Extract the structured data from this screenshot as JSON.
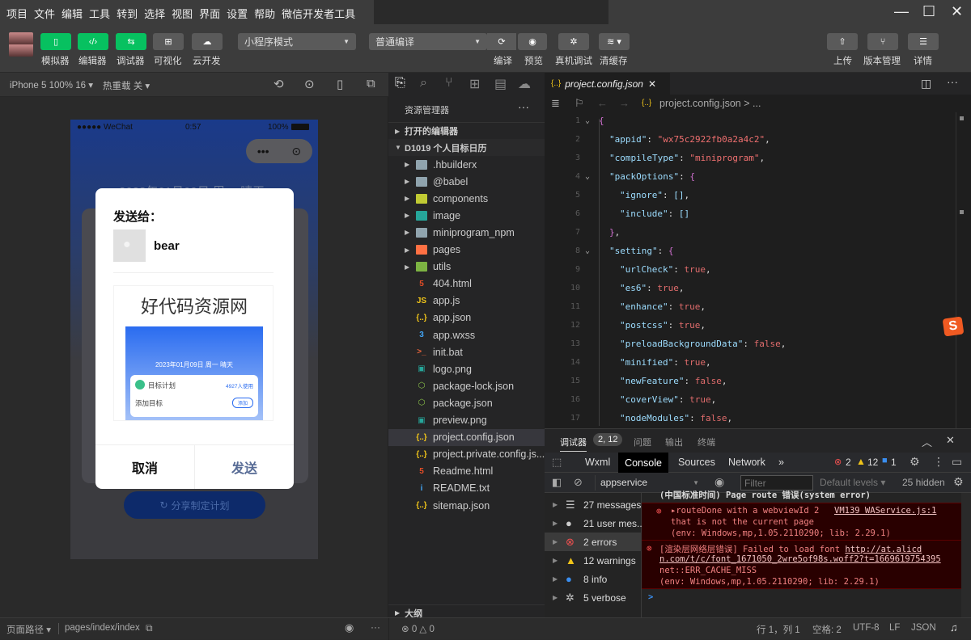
{
  "menubar": {
    "items": [
      "项目",
      "文件",
      "编辑",
      "工具",
      "转到",
      "选择",
      "视图",
      "界面",
      "设置",
      "帮助",
      "微信开发者工具"
    ]
  },
  "window_controls": {
    "minimize": "—",
    "maximize": "☐",
    "close": "✕"
  },
  "toolbar": {
    "left_buttons": [
      {
        "label": "模拟器",
        "icon": "phone-icon",
        "active": true
      },
      {
        "label": "编辑器",
        "icon": "code-icon",
        "active": true
      },
      {
        "label": "调试器",
        "icon": "sliders-icon",
        "active": true
      },
      {
        "label": "可视化",
        "icon": "layout-icon",
        "active": false
      },
      {
        "label": "云开发",
        "icon": "cloud-icon",
        "active": false
      }
    ],
    "mode_select": "小程序模式",
    "compile_select": "普通编译",
    "mid_buttons": [
      {
        "label": "编译",
        "icon": "refresh-icon"
      },
      {
        "label": "预览",
        "icon": "eye-icon"
      },
      {
        "label": "真机调试",
        "icon": "bug-icon"
      },
      {
        "label": "清缓存",
        "icon": "layers-icon"
      }
    ],
    "right_buttons": [
      {
        "label": "上传",
        "icon": "upload-icon"
      },
      {
        "label": "版本管理",
        "icon": "branch-icon"
      },
      {
        "label": "详情",
        "icon": "menu-icon"
      }
    ],
    "accent": "#07c160"
  },
  "simulator": {
    "device": "iPhone 5 100% 16",
    "hot_reload": "热重载 关",
    "status_bar": {
      "carrier": "●●●●● WeChat",
      "time": "0:57",
      "battery": "100%"
    },
    "bg_date": "2023年01月09日 周一 晴天",
    "share_button": "分享制定计划",
    "dialog": {
      "title": "发送给：",
      "user": "bear",
      "card_title": "好代码资源网",
      "preview": {
        "date": "2023年01月09日 周一 晴天",
        "plan": "目标计划",
        "users": "4927人使用",
        "add_goal": "添加目标",
        "add_btn": "添加"
      },
      "cancel": "取消",
      "send": "发送"
    }
  },
  "explorer": {
    "title": "资源管理器",
    "open_editors": "打开的编辑器",
    "project": "D1019 个人目标日历",
    "folders": [
      {
        "name": ".hbuilderx",
        "color": "#90a4ae"
      },
      {
        "name": "@babel",
        "color": "#90a4ae"
      },
      {
        "name": "components",
        "color": "#c0ca33"
      },
      {
        "name": "image",
        "color": "#26a69a"
      },
      {
        "name": "miniprogram_npm",
        "color": "#90a4ae"
      },
      {
        "name": "pages",
        "color": "#ff7043"
      },
      {
        "name": "utils",
        "color": "#7cb342"
      }
    ],
    "files": [
      {
        "name": "404.html",
        "icon": "html5-icon",
        "glyph": "5",
        "color": "#e44d26"
      },
      {
        "name": "app.js",
        "icon": "js-icon",
        "glyph": "JS",
        "color": "#f0c419"
      },
      {
        "name": "app.json",
        "icon": "json-icon",
        "glyph": "{..}",
        "color": "#f0c419"
      },
      {
        "name": "app.wxss",
        "icon": "css3-icon",
        "glyph": "3",
        "color": "#42a5f5"
      },
      {
        "name": "init.bat",
        "icon": "terminal-icon",
        "glyph": ">_",
        "color": "#e8643c"
      },
      {
        "name": "logo.png",
        "icon": "image-file-icon",
        "glyph": "▣",
        "color": "#26a69a"
      },
      {
        "name": "package-lock.json",
        "icon": "nodejs-icon",
        "glyph": "⬡",
        "color": "#8bc34a"
      },
      {
        "name": "package.json",
        "icon": "nodejs-icon",
        "glyph": "⬡",
        "color": "#8bc34a"
      },
      {
        "name": "preview.png",
        "icon": "image-file-icon",
        "glyph": "▣",
        "color": "#26a69a"
      },
      {
        "name": "project.config.json",
        "icon": "json-icon",
        "glyph": "{..}",
        "color": "#f0c419",
        "selected": true
      },
      {
        "name": "project.private.config.js...",
        "icon": "json-icon",
        "glyph": "{..}",
        "color": "#f0c419"
      },
      {
        "name": "Readme.html",
        "icon": "html5-icon",
        "glyph": "5",
        "color": "#e44d26"
      },
      {
        "name": "README.txt",
        "icon": "info-icon",
        "glyph": "i",
        "color": "#42a5f5"
      },
      {
        "name": "sitemap.json",
        "icon": "json-icon",
        "glyph": "{..}",
        "color": "#f0c419"
      }
    ],
    "outline": "大纲"
  },
  "editor": {
    "tab": "project.config.json",
    "breadcrumb": "project.config.json > ...",
    "lines": [
      {
        "n": "1",
        "fold": true,
        "ind": 0,
        "parts": [
          [
            "cbr",
            "{"
          ]
        ]
      },
      {
        "n": "2",
        "ind": 1,
        "parts": [
          [
            "ck",
            "\"appid\""
          ],
          [
            "cp",
            ": "
          ],
          [
            "cs",
            "\"wx75c2922fb0a2a4c2\""
          ],
          [
            "cp",
            ","
          ]
        ]
      },
      {
        "n": "3",
        "ind": 1,
        "parts": [
          [
            "ck",
            "\"compileType\""
          ],
          [
            "cp",
            ": "
          ],
          [
            "cs",
            "\"miniprogram\""
          ],
          [
            "cp",
            ","
          ]
        ]
      },
      {
        "n": "4",
        "fold": true,
        "ind": 1,
        "parts": [
          [
            "ck",
            "\"packOptions\""
          ],
          [
            "cp",
            ": "
          ],
          [
            "cbr",
            "{"
          ]
        ]
      },
      {
        "n": "5",
        "ind": 2,
        "parts": [
          [
            "ck",
            "\"ignore\""
          ],
          [
            "cp",
            ": "
          ],
          [
            "ck",
            "[]"
          ],
          [
            "cp",
            ","
          ]
        ]
      },
      {
        "n": "6",
        "ind": 2,
        "parts": [
          [
            "ck",
            "\"include\""
          ],
          [
            "cp",
            ": "
          ],
          [
            "ck",
            "[]"
          ]
        ]
      },
      {
        "n": "7",
        "ind": 1,
        "parts": [
          [
            "cbr",
            "}"
          ],
          [
            "cp",
            ","
          ]
        ]
      },
      {
        "n": "8",
        "fold": true,
        "ind": 1,
        "parts": [
          [
            "ck",
            "\"setting\""
          ],
          [
            "cp",
            ": "
          ],
          [
            "cbr",
            "{"
          ]
        ]
      },
      {
        "n": "9",
        "ind": 2,
        "parts": [
          [
            "ck",
            "\"urlCheck\""
          ],
          [
            "cp",
            ": "
          ],
          [
            "cb",
            "true"
          ],
          [
            "cp",
            ","
          ]
        ]
      },
      {
        "n": "10",
        "ind": 2,
        "parts": [
          [
            "ck",
            "\"es6\""
          ],
          [
            "cp",
            ": "
          ],
          [
            "cb",
            "true"
          ],
          [
            "cp",
            ","
          ]
        ]
      },
      {
        "n": "11",
        "ind": 2,
        "parts": [
          [
            "ck",
            "\"enhance\""
          ],
          [
            "cp",
            ": "
          ],
          [
            "cb",
            "true"
          ],
          [
            "cp",
            ","
          ]
        ]
      },
      {
        "n": "12",
        "ind": 2,
        "parts": [
          [
            "ck",
            "\"postcss\""
          ],
          [
            "cp",
            ": "
          ],
          [
            "cb",
            "true"
          ],
          [
            "cp",
            ","
          ]
        ]
      },
      {
        "n": "13",
        "ind": 2,
        "parts": [
          [
            "ck",
            "\"preloadBackgroundData\""
          ],
          [
            "cp",
            ": "
          ],
          [
            "cb",
            "false"
          ],
          [
            "cp",
            ","
          ]
        ]
      },
      {
        "n": "14",
        "ind": 2,
        "parts": [
          [
            "ck",
            "\"minified\""
          ],
          [
            "cp",
            ": "
          ],
          [
            "cb",
            "true"
          ],
          [
            "cp",
            ","
          ]
        ]
      },
      {
        "n": "15",
        "ind": 2,
        "parts": [
          [
            "ck",
            "\"newFeature\""
          ],
          [
            "cp",
            ": "
          ],
          [
            "cb",
            "false"
          ],
          [
            "cp",
            ","
          ]
        ]
      },
      {
        "n": "16",
        "ind": 2,
        "parts": [
          [
            "ck",
            "\"coverView\""
          ],
          [
            "cp",
            ": "
          ],
          [
            "cb",
            "true"
          ],
          [
            "cp",
            ","
          ]
        ]
      },
      {
        "n": "17",
        "ind": 2,
        "parts": [
          [
            "ck",
            "\"nodeModules\""
          ],
          [
            "cp",
            ": "
          ],
          [
            "cb",
            "false"
          ],
          [
            "cp",
            ","
          ]
        ]
      }
    ]
  },
  "debugger": {
    "tabs": [
      "调试器",
      "问题",
      "输出",
      "终端"
    ],
    "badge": "2, 12",
    "devtools_tabs": [
      "Wxml",
      "Console",
      "Sources",
      "Network",
      "»"
    ],
    "counts": {
      "errors": "2",
      "warnings": "12",
      "info": "1"
    },
    "context": "appservice",
    "filter_placeholder": "Filter",
    "levels": "Default levels ▾",
    "hidden": "25 hidden",
    "sidebar": [
      {
        "label": "27 messages",
        "icon": "list-icon"
      },
      {
        "label": "21 user mes...",
        "icon": "user-icon"
      },
      {
        "label": "2 errors",
        "icon": "error-icon"
      },
      {
        "label": "12 warnings",
        "icon": "warning-icon"
      },
      {
        "label": "8 info",
        "icon": "info-icon"
      },
      {
        "label": "5 verbose",
        "icon": "bug-icon"
      }
    ],
    "console": {
      "truncated": "(中国标准时间) Page route 错误(system error)",
      "msg1_a": "▸routeDone with a webviewId 2",
      "msg1_src": "VM139 WAService.js:1",
      "msg1_b": "that is not the current page",
      "msg1_c": "(env: Windows,mp,1.05.2110290; lib: 2.29.1)",
      "msg2_a": "[渲染层网络层错误] Failed to load font ",
      "msg2_link1": "http://at.alicd",
      "msg2_link2": "n.com/t/c/font_1671050_2wre5of98s.woff2?t=1669619754395",
      "msg2_b": "net::ERR_CACHE_MISS",
      "msg2_c": "(env: Windows,mp,1.05.2110290; lib: 2.29.1)",
      "prompt": ">"
    }
  },
  "statusbar": {
    "page_path_label": "页面路径 ▾",
    "page_path": "pages/index/index",
    "problems": "⊗ 0 △ 0",
    "position": "行 1，列 1",
    "spaces": "空格: 2",
    "encoding": "UTF-8",
    "eol": "LF",
    "language": "JSON"
  }
}
